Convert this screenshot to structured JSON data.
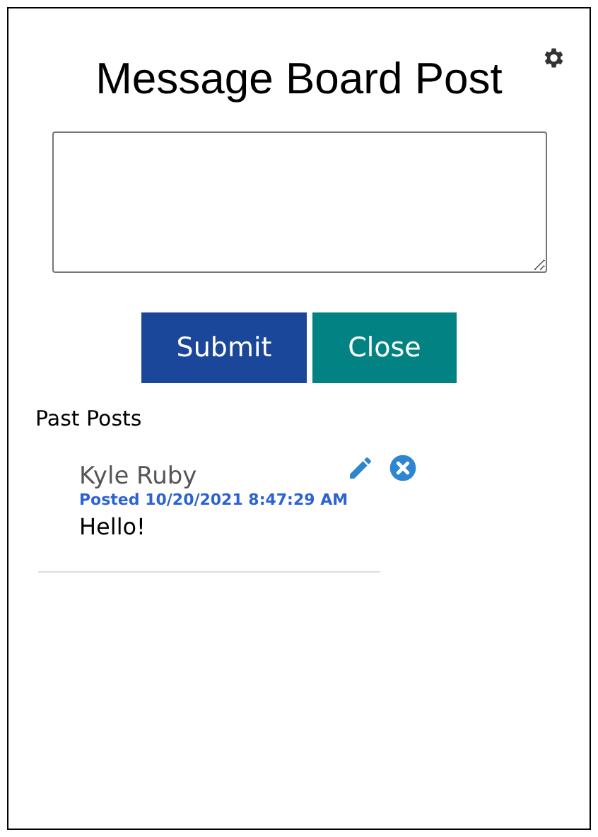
{
  "dialog": {
    "title": "Message Board Post",
    "buttons": [
      {
        "kind": "primary",
        "label": "Submit"
      },
      {
        "kind": "secondary",
        "label": "Close"
      }
    ],
    "past_posts": {
      "heading": "Past Posts",
      "posts": [
        {
          "author": "Kyle Ruby",
          "posted": "Posted 10/20/2021 8:47:29 AM",
          "message": "Hello!"
        }
      ]
    }
  }
}
